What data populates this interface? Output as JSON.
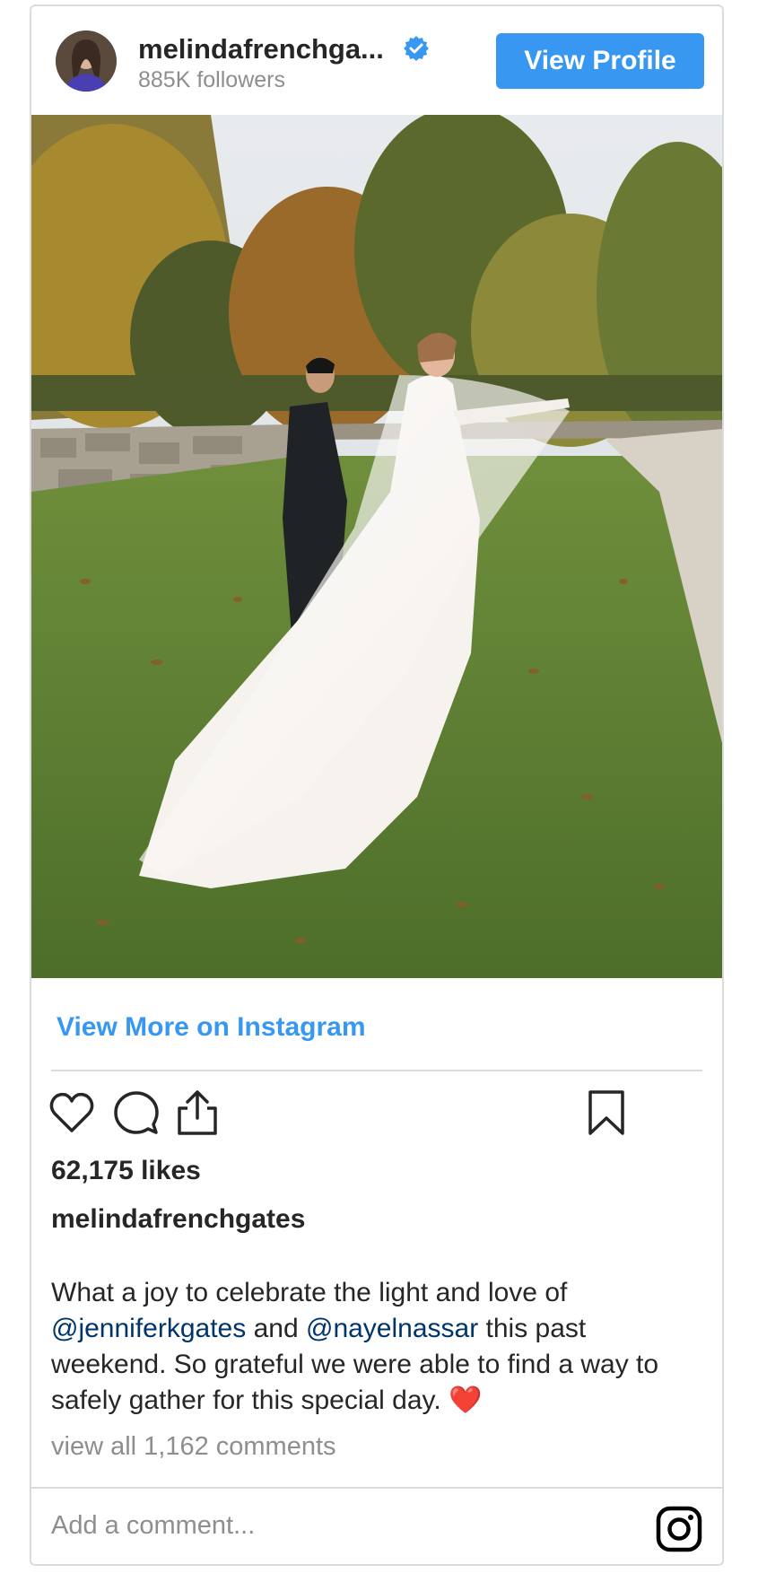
{
  "header": {
    "username": "melindafrenchga...",
    "verified_icon": "verified-badge-icon",
    "followers": "885K followers",
    "view_profile_label": "View Profile",
    "accent_color": "#3897f0"
  },
  "post": {
    "view_more_label": "View More on Instagram",
    "likes": "62,175 likes",
    "author": "melindafrenchgates",
    "caption": {
      "text_1": "What a joy to celebrate the light and love of ",
      "mention_1": "@jenniferkgates",
      "text_2": " and ",
      "mention_2": "@nayelnassar",
      "text_3": " this past weekend. So grateful we were able to find a way to safely gather for this special day. ",
      "emoji": "❤️"
    },
    "view_comments": "view all 1,162 comments",
    "add_comment_placeholder": "Add a comment...",
    "icons": [
      "heart-icon",
      "comment-icon",
      "share-icon",
      "bookmark-icon",
      "instagram-logo-icon"
    ]
  }
}
